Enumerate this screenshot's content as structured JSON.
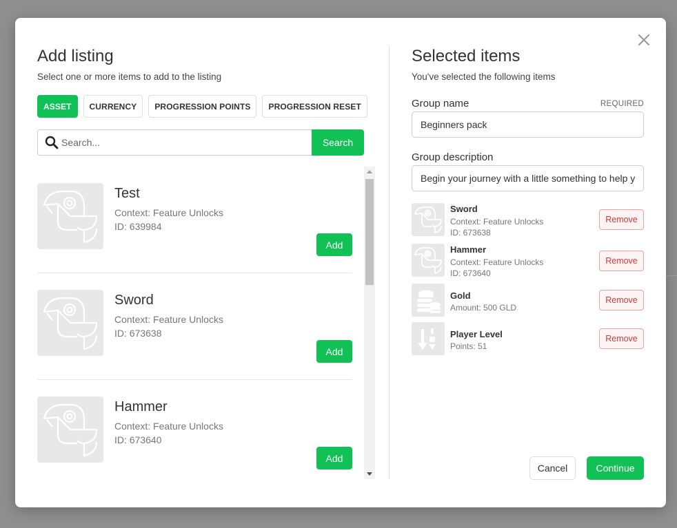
{
  "left_panel": {
    "title": "Add listing",
    "subtitle": "Select one or more items to add to the listing",
    "filters": [
      {
        "label": "ASSET",
        "active": true
      },
      {
        "label": "CURRENCY",
        "active": false
      },
      {
        "label": "PROGRESSION POINTS",
        "active": false
      },
      {
        "label": "PROGRESSION RESET",
        "active": false
      }
    ],
    "search": {
      "placeholder": "Search...",
      "button_label": "Search",
      "icon": "search-icon"
    },
    "items": [
      {
        "name": "Test",
        "context": "Context: Feature Unlocks",
        "id": "ID: 639984",
        "add_label": "Add",
        "icon": "parrot-placeholder-icon"
      },
      {
        "name": "Sword",
        "context": "Context: Feature Unlocks",
        "id": "ID: 673638",
        "add_label": "Add",
        "icon": "parrot-placeholder-icon"
      },
      {
        "name": "Hammer",
        "context": "Context: Feature Unlocks",
        "id": "ID: 673640",
        "add_label": "Add",
        "icon": "parrot-placeholder-icon"
      }
    ]
  },
  "right_panel": {
    "title": "Selected items",
    "subtitle": "You've selected the following items",
    "group_name": {
      "label": "Group name",
      "required": "REQUIRED",
      "value": "Beginners pack"
    },
    "group_description": {
      "label": "Group description",
      "value": "Begin your journey with a little something to help you along"
    },
    "selected": [
      {
        "name": "Sword",
        "line1": "Context: Feature Unlocks",
        "line2": "ID: 673638",
        "remove_label": "Remove",
        "icon": "parrot-placeholder-icon"
      },
      {
        "name": "Hammer",
        "line1": "Context: Feature Unlocks",
        "line2": "ID: 673640",
        "remove_label": "Remove",
        "icon": "parrot-placeholder-icon"
      },
      {
        "name": "Gold",
        "line1": "Amount: 500 GLD",
        "remove_label": "Remove",
        "icon": "coins-icon"
      },
      {
        "name": "Player Level",
        "line1": "Points: 51",
        "remove_label": "Remove",
        "icon": "sort-arrows-icon"
      }
    ],
    "cancel_label": "Cancel",
    "continue_label": "Continue"
  },
  "colors": {
    "accent": "#12c156",
    "danger": "#d03a3a",
    "backdrop": "#8f8f8f"
  }
}
